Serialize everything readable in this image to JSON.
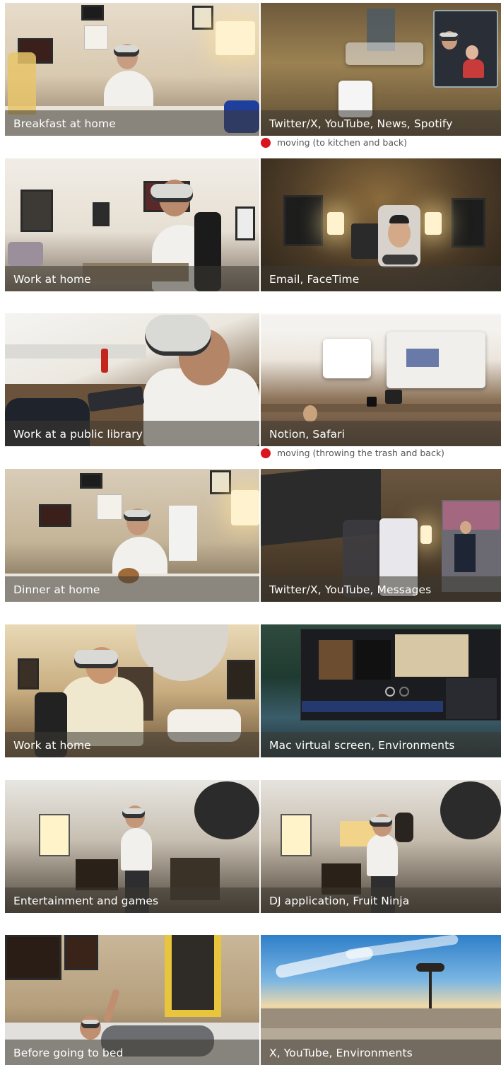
{
  "rows": [
    {
      "left_caption": "Breakfast at home",
      "right_caption": "Twitter/X, YouTube, News, Spotify",
      "note": "moving (to kitchen and back)"
    },
    {
      "left_caption": "Work at home",
      "right_caption": "Email, FaceTime"
    },
    {
      "left_caption": "Work at a public library",
      "right_caption": "Notion, Safari",
      "note": "moving (throwing the trash and back)"
    },
    {
      "left_caption": "Dinner at home",
      "right_caption": "Twitter/X, YouTube, Messages"
    },
    {
      "left_caption": "Work at home",
      "right_caption": "Mac virtual screen, Environments"
    },
    {
      "left_caption": "Entertainment and games",
      "right_caption": "DJ application, Fruit Ninja"
    },
    {
      "left_caption": "Before going to bed",
      "right_caption": "X, YouTube, Environments"
    }
  ],
  "colors": {
    "note_dot": "#d8151f",
    "caption_text": "#ffffff"
  }
}
